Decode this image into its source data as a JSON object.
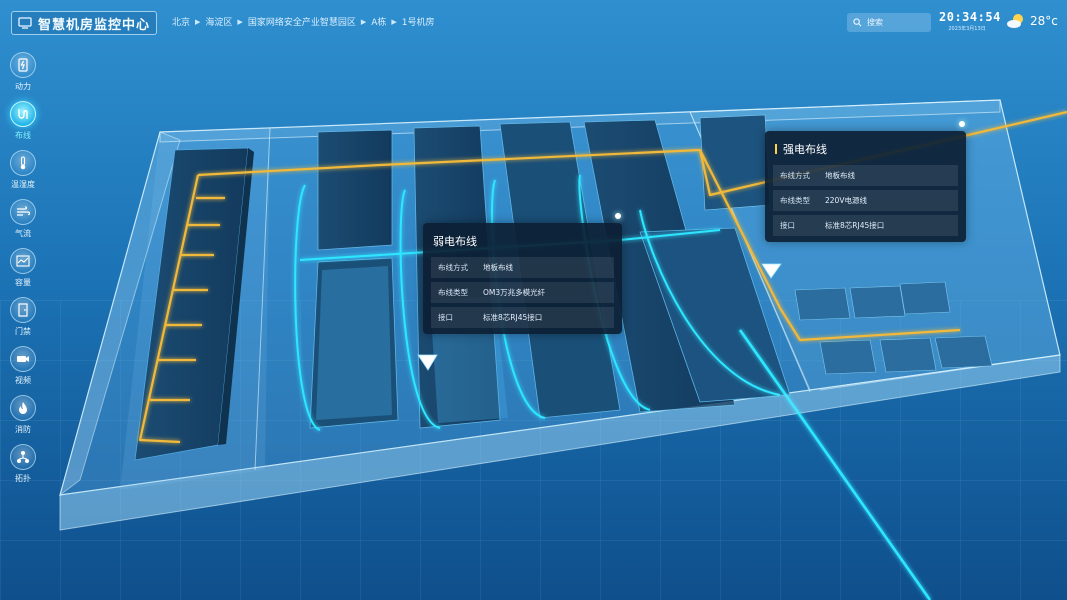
{
  "app": {
    "title": "智慧机房监控中心"
  },
  "breadcrumb": [
    "北京",
    "海淀区",
    "国家网络安全产业智慧园区",
    "A栋",
    "1号机房"
  ],
  "search": {
    "placeholder": "搜索"
  },
  "clock": {
    "time": "20:34:54",
    "date": "2023年3月13日"
  },
  "weather": {
    "temp": "28°c",
    "icon": "partly-cloudy-icon"
  },
  "sidebar": {
    "active_index": 1,
    "items": [
      {
        "label": "动力",
        "icon": "power-icon"
      },
      {
        "label": "布线",
        "icon": "cabling-icon"
      },
      {
        "label": "温湿度",
        "icon": "thermometer-icon"
      },
      {
        "label": "气流",
        "icon": "airflow-icon"
      },
      {
        "label": "容量",
        "icon": "capacity-icon"
      },
      {
        "label": "门禁",
        "icon": "door-icon"
      },
      {
        "label": "视频",
        "icon": "camera-icon"
      },
      {
        "label": "消防",
        "icon": "fire-icon"
      },
      {
        "label": "拓扑",
        "icon": "topology-icon"
      }
    ]
  },
  "panels": {
    "strong": {
      "title": "强电布线",
      "rows": [
        {
          "k": "布线方式",
          "v": "地板布线"
        },
        {
          "k": "布线类型",
          "v": "220V电源线"
        },
        {
          "k": "接口",
          "v": "标准8芯RJ45接口"
        }
      ]
    },
    "weak": {
      "title": "弱电布线",
      "rows": [
        {
          "k": "布线方式",
          "v": "地板布线"
        },
        {
          "k": "布线类型",
          "v": "OM3万兆多模光纤"
        },
        {
          "k": "接口",
          "v": "标准8芯RJ45接口"
        }
      ]
    }
  },
  "colors": {
    "background": "#1a6fb0",
    "strong_cable": "#f0b93a",
    "weak_cable": "#2fe6ff",
    "panel": "#0c2034"
  }
}
